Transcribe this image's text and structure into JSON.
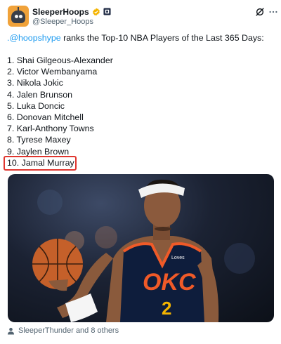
{
  "author": {
    "display_name": "SleeperHoops",
    "handle": "@Sleeper_Hoops",
    "avatar_icon": "robot-logo",
    "verified_icon": "verified-badge",
    "affiliate_icon": "affiliate-badge"
  },
  "header_icons": [
    "grok-icon",
    "more-options-icon"
  ],
  "tweet": {
    "mention": ".@hoopshype",
    "intro_rest": " ranks the Top-10 NBA Players of the Last 365 Days:",
    "players": [
      "1. Shai Gilgeous-Alexander",
      "2. Victor Wembanyama",
      "3. Nikola Jokic",
      "4. Jalen Brunson",
      "5. Luka Doncic",
      "6. Donovan Mitchell",
      "7. Karl-Anthony Towns",
      "8. Tyrese Maxey",
      "9. Jaylen Brown",
      "10. Jamal Murray"
    ],
    "highlighted_index": 9
  },
  "media": {
    "jersey_text": "OKC",
    "jersey_number": "2",
    "jersey_patch": "Loves"
  },
  "footer": {
    "tagged": "SleeperThunder and 8 others",
    "icon": "person-icon"
  },
  "colors": {
    "mention": "#1d9bf0",
    "highlight_border": "#e0362f",
    "verified": "#f4b400",
    "jersey": "#0e1d3c",
    "jersey_accent": "#f05a28"
  }
}
